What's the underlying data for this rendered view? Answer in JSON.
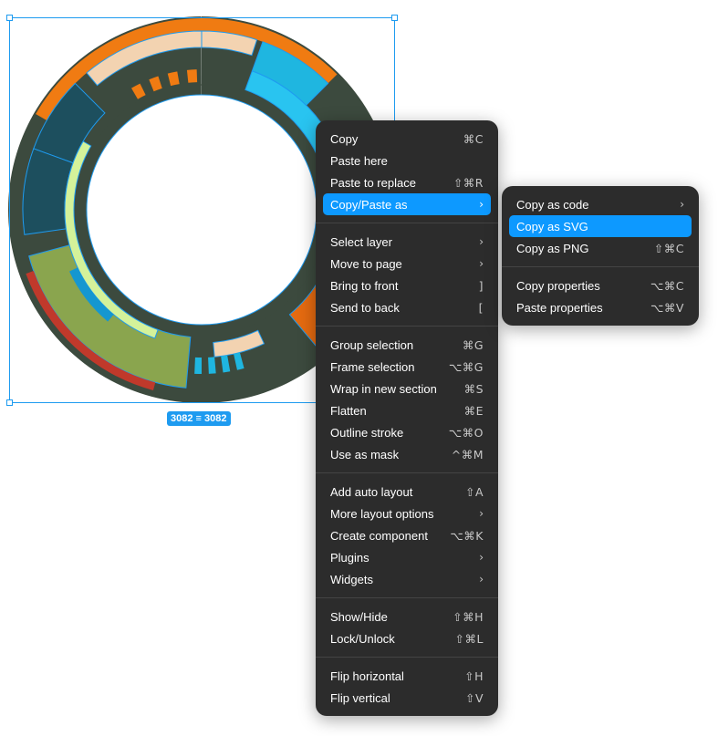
{
  "selection": {
    "width_label": "3082",
    "height_label": "3082",
    "separator_glyph": "≡"
  },
  "main_menu": {
    "groups": [
      [
        {
          "label": "Copy",
          "shortcut": "⌘C"
        },
        {
          "label": "Paste here",
          "shortcut": ""
        },
        {
          "label": "Paste to replace",
          "shortcut": "⇧⌘R"
        },
        {
          "label": "Copy/Paste as",
          "shortcut": "›"
        }
      ],
      [
        {
          "label": "Select layer",
          "shortcut": "›"
        },
        {
          "label": "Move to page",
          "shortcut": "›"
        },
        {
          "label": "Bring to front",
          "shortcut": "]"
        },
        {
          "label": "Send to back",
          "shortcut": "["
        }
      ],
      [
        {
          "label": "Group selection",
          "shortcut": "⌘G"
        },
        {
          "label": "Frame selection",
          "shortcut": "⌥⌘G"
        },
        {
          "label": "Wrap in new section",
          "shortcut": "⌘S"
        },
        {
          "label": "Flatten",
          "shortcut": "⌘E"
        },
        {
          "label": "Outline stroke",
          "shortcut": "⌥⌘O"
        },
        {
          "label": "Use as mask",
          "shortcut": "^⌘M"
        }
      ],
      [
        {
          "label": "Add auto layout",
          "shortcut": "⇧A"
        },
        {
          "label": "More layout options",
          "shortcut": "›"
        },
        {
          "label": "Create component",
          "shortcut": "⌥⌘K"
        },
        {
          "label": "Plugins",
          "shortcut": "›"
        },
        {
          "label": "Widgets",
          "shortcut": "›"
        }
      ],
      [
        {
          "label": "Show/Hide",
          "shortcut": "⇧⌘H"
        },
        {
          "label": "Lock/Unlock",
          "shortcut": "⇧⌘L"
        }
      ],
      [
        {
          "label": "Flip horizontal",
          "shortcut": "⇧H"
        },
        {
          "label": "Flip vertical",
          "shortcut": "⇧V"
        }
      ]
    ]
  },
  "sub_menu": {
    "groups": [
      [
        {
          "label": "Copy as code",
          "shortcut": "›"
        },
        {
          "label": "Copy as SVG",
          "shortcut": ""
        },
        {
          "label": "Copy as PNG",
          "shortcut": "⇧⌘C"
        }
      ],
      [
        {
          "label": "Copy properties",
          "shortcut": "⌥⌘C"
        },
        {
          "label": "Paste properties",
          "shortcut": "⌥⌘V"
        }
      ]
    ]
  },
  "colors": {
    "menu_bg": "#2c2c2c",
    "highlight": "#0d99ff",
    "selection": "#1e9bf0"
  }
}
